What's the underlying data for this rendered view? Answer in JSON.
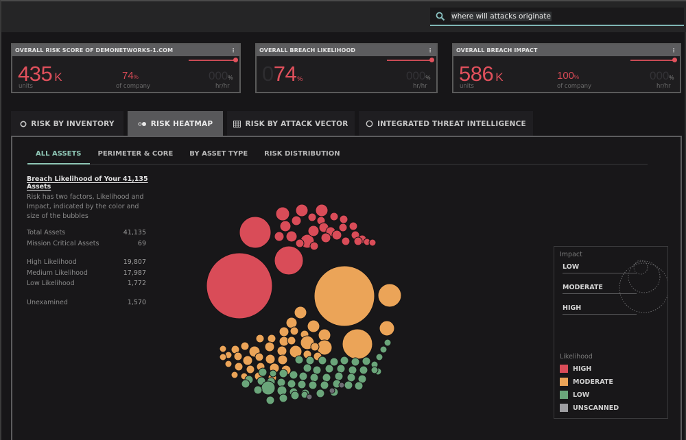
{
  "search": {
    "icon": "search-icon",
    "value": "where will attacks originate",
    "accent": "#7fb6b5"
  },
  "kpis": [
    {
      "title": "OVERALL RISK SCORE OF DEMONETWORKS-1.COM",
      "menu": "⋮",
      "value": "435",
      "value_unit": "K",
      "value_label": "units",
      "mid_value": "74",
      "mid_unit": "%",
      "mid_label": "of company",
      "rate_value": "000",
      "rate_unit": "%",
      "rate_label": "hr/hr",
      "slider_level": 1.0
    },
    {
      "title": "OVERALL BREACH LIKELIHOOD",
      "menu": "⋮",
      "value_ghost": "0",
      "value": "74",
      "value_unit": "%",
      "rate_value": "000",
      "rate_unit": "%",
      "rate_label": "hr/hr",
      "slider_level": 1.0
    },
    {
      "title": "OVERALL BREACH IMPACT",
      "menu": "⋮",
      "value": "586",
      "value_unit": "K",
      "value_label": "units",
      "mid_value": "100",
      "mid_unit": "%",
      "mid_label": "of company",
      "rate_value": "000",
      "rate_unit": "%",
      "rate_label": "hr/hr",
      "slider_level": 1.0
    }
  ],
  "tabs": [
    {
      "label": "RISK BY INVENTORY",
      "icon": "ring-icon",
      "active": false
    },
    {
      "label": "RISK HEATMAP",
      "icon": "bubbles-icon",
      "active": true
    },
    {
      "label": "RISK BY ATTACK VECTOR",
      "icon": "grid-icon",
      "active": false
    },
    {
      "label": "INTEGRATED THREAT INTELLIGENCE",
      "icon": "circle-icon",
      "active": false
    }
  ],
  "subtabs": [
    {
      "label": "ALL ASSETS",
      "active": true
    },
    {
      "label": "PERIMETER & CORE",
      "active": false
    },
    {
      "label": "BY ASSET TYPE",
      "active": false
    },
    {
      "label": "RISK DISTRIBUTION",
      "active": false
    }
  ],
  "info": {
    "title": "Breach Likelihood of Your 41,135 Assets",
    "description": "Risk has two factors, Likelihood and Impact, indicated by the color and size of the bubbles"
  },
  "stats": {
    "group1": [
      {
        "label": "Total Assets",
        "value": "41,135"
      },
      {
        "label": "Mission Critical Assets",
        "value": "69"
      }
    ],
    "group2": [
      {
        "label": "High Likelihood",
        "value": "19,807"
      },
      {
        "label": "Medium Likelihood",
        "value": "17,987"
      },
      {
        "label": "Low Likelihood",
        "value": "1,772"
      }
    ],
    "group3": [
      {
        "label": "Unexamined",
        "value": "1,570"
      }
    ]
  },
  "legend": {
    "impact_title": "Impact",
    "impact_levels": [
      "LOW",
      "MODERATE",
      "HIGH"
    ],
    "likelihood_title": "Likelihood",
    "likelihood_levels": [
      {
        "label": "HIGH",
        "color": "#d94c58"
      },
      {
        "label": "MODERATE",
        "color": "#eba458"
      },
      {
        "label": "LOW",
        "color": "#6aa57a"
      },
      {
        "label": "UNSCANNED",
        "color": "#9e9ea2"
      }
    ]
  },
  "colors": {
    "high": "#d94c58",
    "moderate": "#eba458",
    "low": "#6aa57a",
    "unscanned": "#6e6c74",
    "kpi_value": "#e0505c"
  }
}
